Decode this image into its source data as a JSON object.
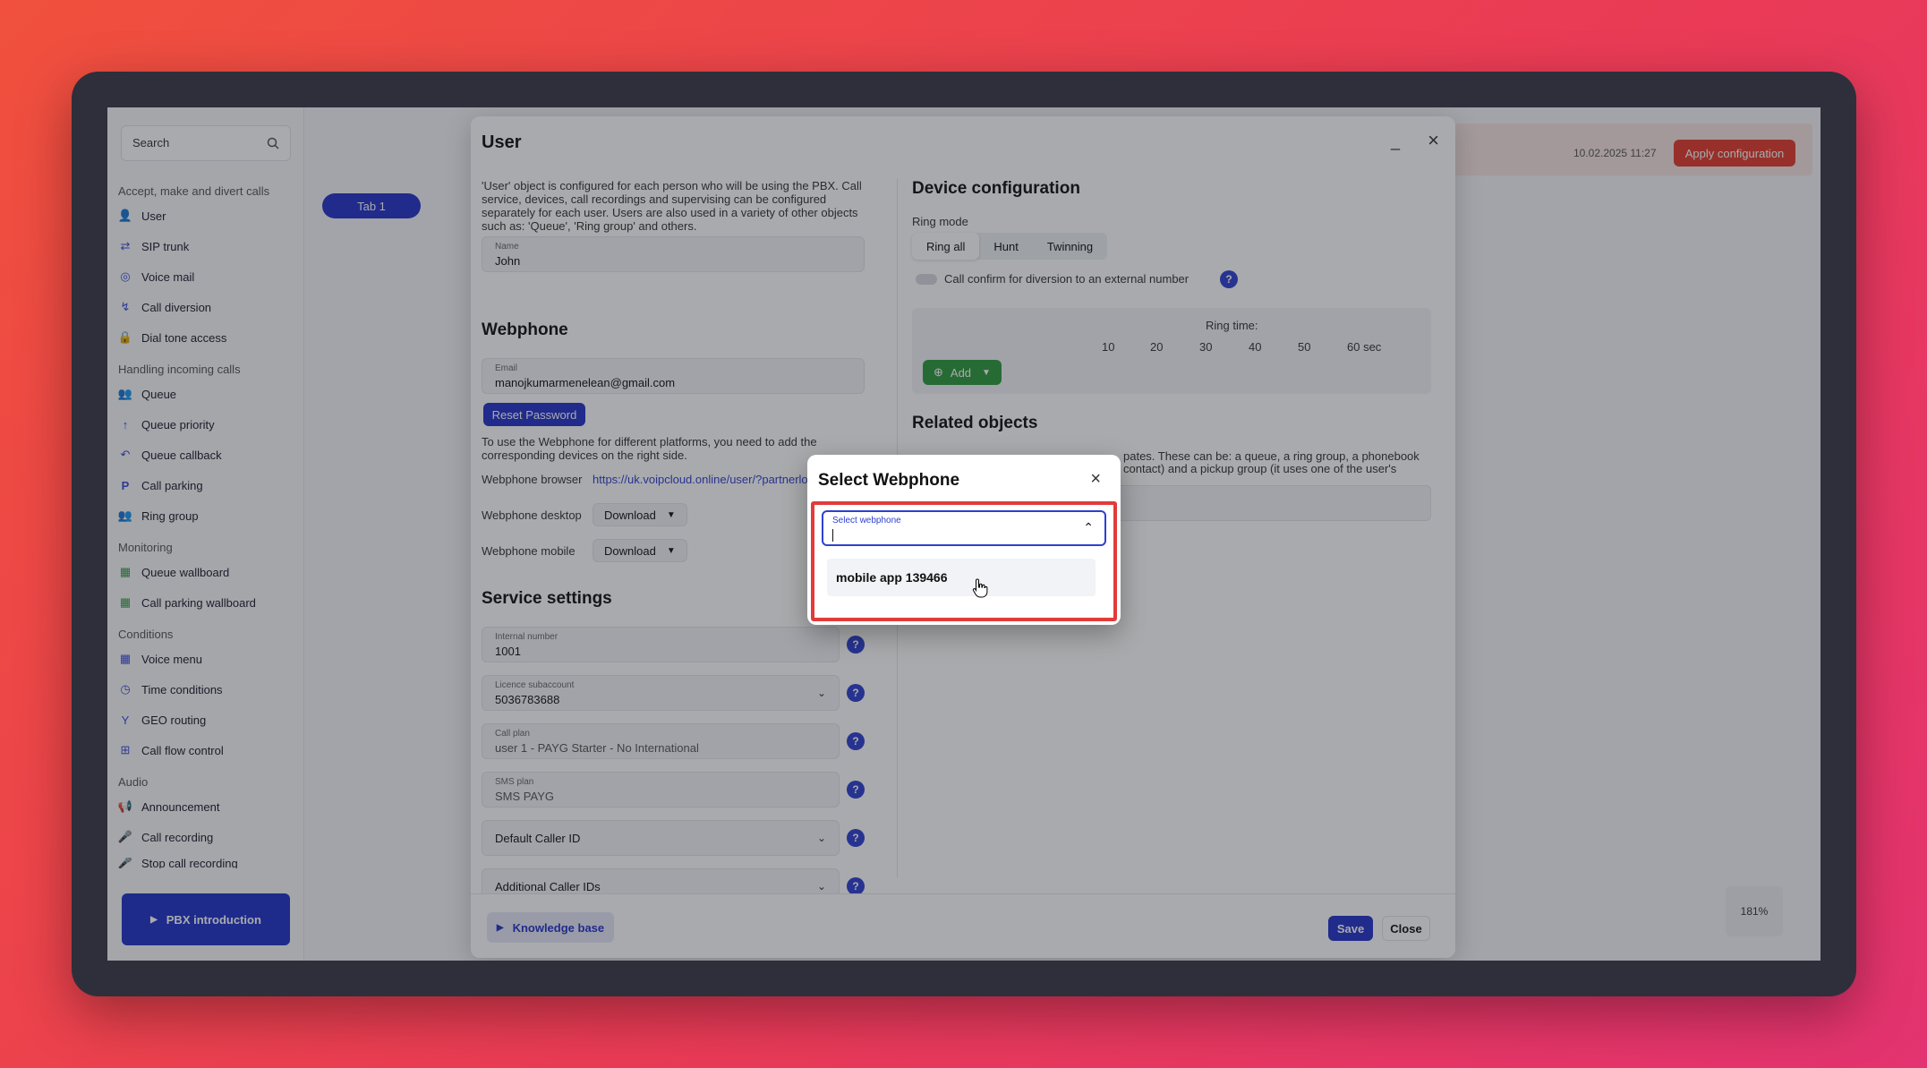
{
  "sidebar": {
    "search_placeholder": "Search",
    "sections": [
      {
        "title": "Accept, make and divert calls",
        "items": [
          {
            "label": "User",
            "icon": "user-icon"
          },
          {
            "label": "SIP trunk",
            "icon": "sip-trunk-icon"
          },
          {
            "label": "Voice mail",
            "icon": "voicemail-icon"
          },
          {
            "label": "Call diversion",
            "icon": "call-diversion-icon"
          },
          {
            "label": "Dial tone access",
            "icon": "lock-icon"
          }
        ]
      },
      {
        "title": "Handling incoming calls",
        "items": [
          {
            "label": "Queue",
            "icon": "queue-icon"
          },
          {
            "label": "Queue priority",
            "icon": "arrow-up-icon"
          },
          {
            "label": "Queue callback",
            "icon": "callback-icon"
          },
          {
            "label": "Call parking",
            "icon": "parking-icon"
          },
          {
            "label": "Ring group",
            "icon": "group-icon"
          }
        ]
      },
      {
        "title": "Monitoring",
        "items": [
          {
            "label": "Queue wallboard",
            "icon": "wallboard-icon"
          },
          {
            "label": "Call parking wallboard",
            "icon": "wallboard-icon"
          }
        ]
      },
      {
        "title": "Conditions",
        "items": [
          {
            "label": "Voice menu",
            "icon": "grid-icon"
          },
          {
            "label": "Time conditions",
            "icon": "clock-icon"
          },
          {
            "label": "GEO routing",
            "icon": "geo-icon"
          },
          {
            "label": "Call flow control",
            "icon": "map-icon"
          }
        ]
      },
      {
        "title": "Audio",
        "items": [
          {
            "label": "Announcement",
            "icon": "megaphone-icon"
          },
          {
            "label": "Call recording",
            "icon": "mic-icon"
          },
          {
            "label": "Stop call recording",
            "icon": "mic-off-icon"
          }
        ]
      }
    ],
    "pbx_intro_label": "PBX introduction"
  },
  "background": {
    "tab1": "Tab 1",
    "datetime": "10.02.2025 11:27",
    "apply_label": "Apply configuration",
    "zoom": "181%"
  },
  "user_dialog": {
    "title": "User",
    "minimize": "_",
    "close": "×",
    "description": "'User' object is configured for each person who will be using the PBX. Call service, devices, call recordings and supervising can be configured separately for each user. Users are also used in a variety of other objects such as: 'Queue', 'Ring group' and others.",
    "name_label": "Name",
    "name_value": "John",
    "webphone_title": "Webphone",
    "email_label": "Email",
    "email_value": "manojkumarmenelean@gmail.com",
    "reset_password": "Reset Password",
    "webphone_desc": "To use the Webphone for different platforms, you need to add the corresponding devices on the right side.",
    "webphone_browser_label": "Webphone browser",
    "webphone_browser_link": "https://uk.voipcloud.online/user/?partnerlo",
    "webphone_desktop_label": "Webphone desktop",
    "webphone_mobile_label": "Webphone mobile",
    "download_label": "Download",
    "service_title": "Service settings",
    "internal_number_label": "Internal number",
    "internal_number_value": "1001",
    "licence_label": "Licence subaccount",
    "licence_value": "5036783688",
    "call_plan_label": "Call plan",
    "call_plan_value": "user 1 - PAYG Starter - No International",
    "sms_plan_label": "SMS plan",
    "sms_plan_value": "SMS PAYG",
    "default_caller_id": "Default Caller ID",
    "additional_caller_ids": "Additional Caller IDs",
    "device_config_title": "Device configuration",
    "ring_mode_label": "Ring mode",
    "ring_modes": [
      "Ring all",
      "Hunt",
      "Twinning"
    ],
    "call_confirm_label": "Call confirm for diversion to an external number",
    "ring_time_label": "Ring time:",
    "ring_time_ticks": [
      "10",
      "20",
      "30",
      "40",
      "50",
      "60 sec"
    ],
    "add_label": "Add",
    "related_title": "Related objects",
    "related_desc_line1": "pates. These can be: a queue, a ring group, a phonebook",
    "related_desc_line2": "contact) and a pickup group (it uses one of the user's",
    "knowledge_base": "Knowledge base",
    "save": "Save",
    "close_label": "Close"
  },
  "modal": {
    "title": "Select Webphone",
    "close": "×",
    "select_label": "Select webphone",
    "options": [
      "mobile app 139466"
    ]
  },
  "colors": {
    "accent": "#2233c8",
    "highlight": "#e23b3b",
    "apply": "#e23b2c",
    "add": "#2e9a3c"
  }
}
